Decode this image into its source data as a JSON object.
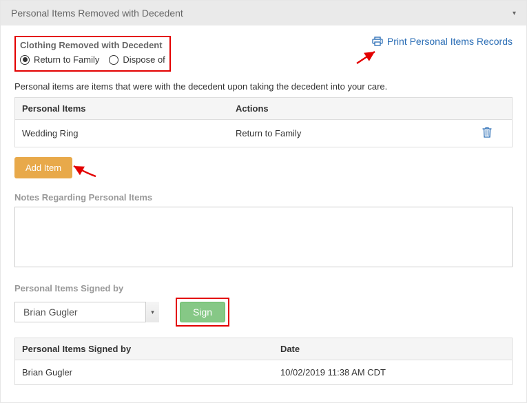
{
  "panel": {
    "title": "Personal Items Removed with Decedent"
  },
  "clothing": {
    "label": "Clothing Removed with Decedent",
    "option1": "Return to Family",
    "option2": "Dispose of"
  },
  "print": {
    "label": "Print Personal Items Records"
  },
  "helper": "Personal items are items that were with the decedent upon taking the decedent into your care.",
  "items": {
    "header_items": "Personal Items",
    "header_actions": "Actions",
    "rows": [
      {
        "name": "Wedding Ring",
        "action": "Return to Family"
      }
    ]
  },
  "add_button": "Add Item",
  "notes_label": "Notes Regarding Personal Items",
  "notes_value": "",
  "signed_by_label": "Personal Items Signed by",
  "signer_select_value": "Brian Gugler",
  "sign_button": "Sign",
  "sig_table": {
    "header_signed": "Personal Items Signed by",
    "header_date": "Date",
    "rows": [
      {
        "name": "Brian Gugler",
        "date": "10/02/2019 11:38 AM CDT"
      }
    ]
  }
}
